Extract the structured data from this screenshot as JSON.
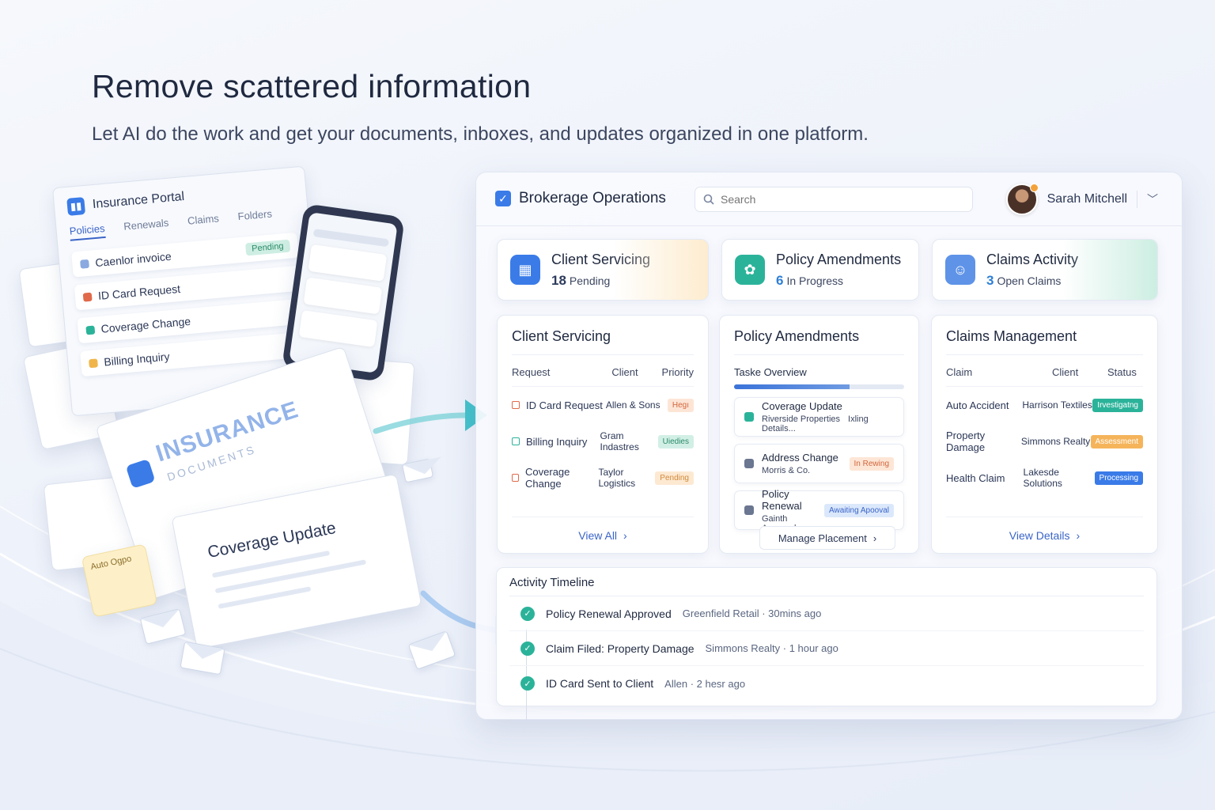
{
  "hero": {
    "title": "Remove scattered information",
    "subtitle": "Let AI do the work and get your documents, inboxes, and updates organized in one platform."
  },
  "illustration": {
    "portal_title": "Insurance Portal",
    "portal_tabs": [
      "Policies",
      "Renewals",
      "Claims",
      "Folders"
    ],
    "portal_items": [
      {
        "label": "Caenlor invoice",
        "badge": "Pending",
        "color": "#8aa9e0"
      },
      {
        "label": "ID Card Request",
        "color": "#e06a4a"
      },
      {
        "label": "Coverage Change",
        "color": "#2bb39a"
      },
      {
        "label": "Billing Inquiry",
        "color": "#f0b54a"
      }
    ],
    "docs_title": "INSURANCE",
    "docs_subtitle": "DOCUMENTS",
    "coverage_paper": "Coverage Update",
    "sticky_note": "Auto Ogpo"
  },
  "topbar": {
    "brand": "Brokerage Operations",
    "search_placeholder": "Search",
    "user_name": "Sarah Mitchell",
    "notification_count": "1"
  },
  "stats": [
    {
      "title": "Client Servicing",
      "value": "18",
      "label": "Pending",
      "color": "#3a7be8",
      "icon": "grid-icon"
    },
    {
      "title": "Policy Amendments",
      "value": "6",
      "label": "In Progress",
      "color": "#2bb39a",
      "icon": "gear-icon"
    },
    {
      "title": "Claims Activity",
      "value": "3",
      "label": "Open Claims",
      "color": "#5e93e8",
      "icon": "face-icon"
    }
  ],
  "client_servicing": {
    "title": "Client Servicing",
    "columns": [
      "Request",
      "Client",
      "Priority"
    ],
    "rows": [
      {
        "request": "ID Card Request",
        "client": "Allen & Sons",
        "priority": "Hegı",
        "icon_color": "#e06a4a",
        "chip_bg": "#fde5d6",
        "chip_fg": "#d2663c"
      },
      {
        "request": "Billing Inquiry",
        "client": "Gram Indastres",
        "priority": "Uiedies",
        "icon_color": "#2bb39a",
        "chip_bg": "#d2efe6",
        "chip_fg": "#2a8b68"
      },
      {
        "request": "Coverage Change",
        "client": "Taylor Logistics",
        "priority": "Pending",
        "icon_color": "#e06a4a",
        "chip_bg": "#fde9d2",
        "chip_fg": "#d28a3c"
      }
    ],
    "footer": "View All"
  },
  "policy_amendments": {
    "title": "Policy Amendments",
    "subtitle": "Taske Overview",
    "progress": 0.68,
    "items": [
      {
        "title": "Coverage Update",
        "sub": "Riverside Properties",
        "extra": "Ixling Details...",
        "badge": "",
        "icon_color": "#2bb39a"
      },
      {
        "title": "Address Change",
        "sub": "Morris & Co.",
        "badge": "In Rewing",
        "badge_bg": "#fde6d6",
        "badge_fg": "#d2663c",
        "icon_color": "#6b7690"
      },
      {
        "title": "Policy Renewal",
        "sub": "Gainth Approval.",
        "badge": "Awaiting Apooval",
        "badge_bg": "#dbe8fb",
        "badge_fg": "#3a64c8",
        "icon_color": "#6b7690"
      }
    ],
    "footer": "Manage Placement"
  },
  "claims_management": {
    "title": "Claims Management",
    "columns": [
      "Claim",
      "Client",
      "Status"
    ],
    "rows": [
      {
        "claim": "Auto Accident",
        "client": "Harrison Textiles",
        "status": "Irvestigatng",
        "chip_bg": "#2bb39a",
        "chip_fg": "#ffffff"
      },
      {
        "claim": "Property Damage",
        "client": "Simmons Realty",
        "status": "Assessment",
        "chip_bg": "#f5b45a",
        "chip_fg": "#ffffff"
      },
      {
        "claim": "Health Claim",
        "client": "Lakesde Solutions",
        "status": "Processing",
        "chip_bg": "#3a7be8",
        "chip_fg": "#ffffff"
      }
    ],
    "footer": "View Details"
  },
  "timeline": {
    "title": "Activity Timeline",
    "events": [
      {
        "event": "Policy Renewal Approved",
        "meta": "Greenfield Retail · 30mins ago"
      },
      {
        "event": "Claim Filed: Property Damage",
        "meta": "Simmons Realty · 1 hour ago"
      },
      {
        "event": "ID Card Sent to Client",
        "meta": "Allen · 2 hesr ago"
      }
    ]
  }
}
